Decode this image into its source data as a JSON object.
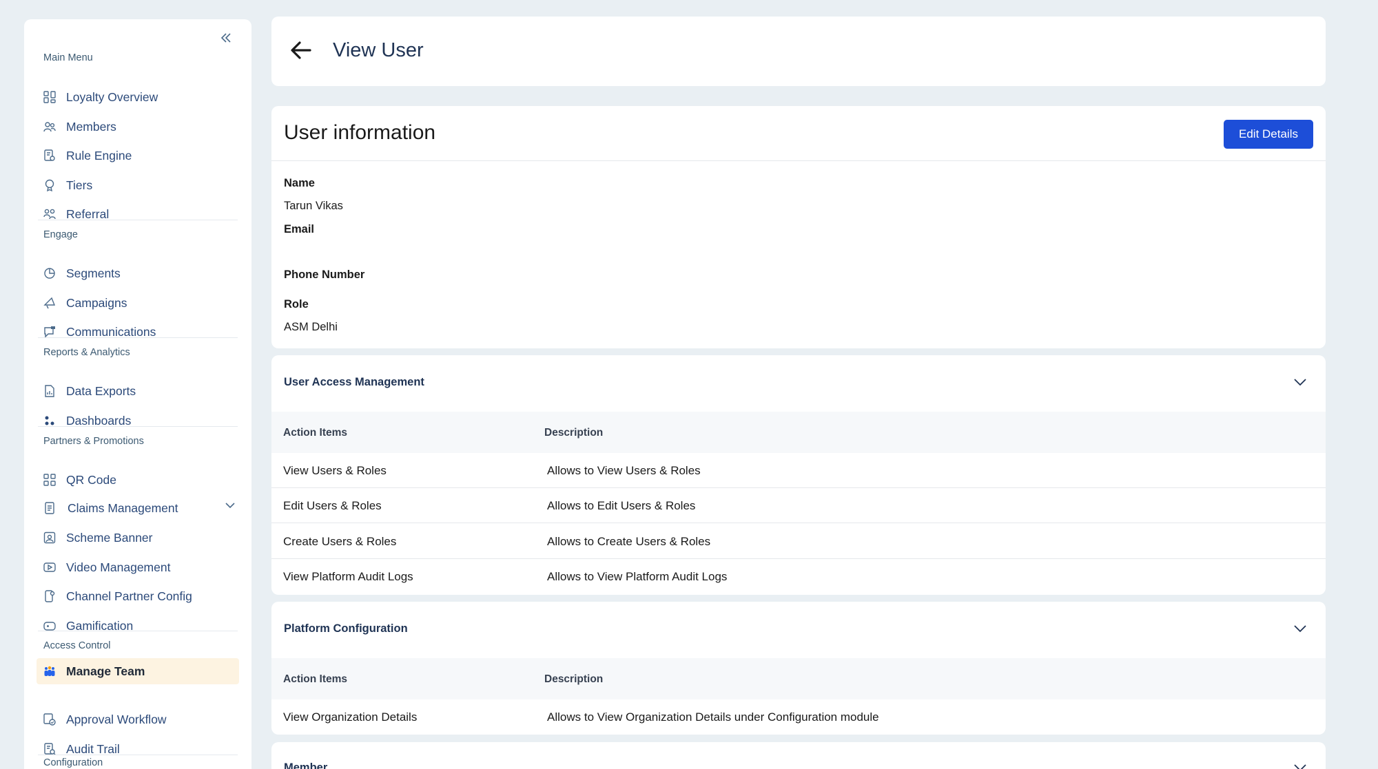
{
  "sidebar": {
    "sections": {
      "main_menu": "Main Menu",
      "engage": "Engage",
      "reports": "Reports & Analytics",
      "partners": "Partners & Promotions",
      "access": "Access Control",
      "configuration": "Configuration"
    },
    "items": {
      "loyalty_overview": "Loyalty Overview",
      "members": "Members",
      "rule_engine": "Rule Engine",
      "tiers": "Tiers",
      "referral": "Referral",
      "segments": "Segments",
      "campaigns": "Campaigns",
      "communications": "Communications",
      "data_exports": "Data Exports",
      "dashboards": "Dashboards",
      "qr_code": "QR Code",
      "claims_management": "Claims Management",
      "scheme_banner": "Scheme Banner",
      "video_management": "Video Management",
      "channel_partner_config": "Channel Partner Config",
      "gamification": "Gamification",
      "manage_team": "Manage Team",
      "approval_workflow": "Approval Workflow",
      "audit_trail": "Audit Trail"
    },
    "active_item": "Manage Team"
  },
  "header": {
    "title": "View User"
  },
  "user_info": {
    "title": "User information",
    "edit_label": "Edit Details",
    "name_label": "Name",
    "name_value": "Tarun Vikas",
    "email_label": "Email",
    "email_value": "",
    "phone_label": "Phone Number",
    "phone_value": "",
    "role_label": "Role",
    "role_value": "ASM Delhi"
  },
  "access_management": {
    "title": "User Access Management",
    "col_action": "Action Items",
    "col_desc": "Description",
    "rows": [
      {
        "action": "View Users & Roles",
        "desc": "Allows to View Users & Roles"
      },
      {
        "action": "Edit Users & Roles",
        "desc": "Allows to Edit Users & Roles"
      },
      {
        "action": "Create Users & Roles",
        "desc": "Allows to Create Users & Roles"
      },
      {
        "action": "View Platform Audit Logs",
        "desc": "Allows to View Platform Audit Logs"
      }
    ]
  },
  "platform_config": {
    "title": "Platform Configuration",
    "col_action": "Action Items",
    "col_desc": "Description",
    "rows": [
      {
        "action": "View Organization Details",
        "desc": "Allows to View Organization Details under Configuration module"
      }
    ]
  },
  "member_section": {
    "title": "Member"
  },
  "colors": {
    "primary": "#1d4ed8",
    "nav_text": "#2c4a7a",
    "active_bg": "#fdf3e1",
    "page_bg": "#e9eff3"
  }
}
